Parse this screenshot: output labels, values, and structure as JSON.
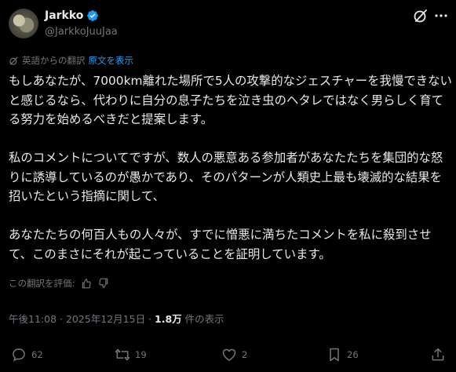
{
  "user": {
    "display_name": "Jarkko",
    "handle": "@JarkkoJuuJaa"
  },
  "translation": {
    "label": "英語からの翻訳",
    "show_original": "原文を表示"
  },
  "tweet": {
    "paragraph1": "もしあなたが、7000km離れた場所で5人の攻撃的なジェスチャーを我慢できないと感じるなら、代わりに自分の息子たちを泣き虫のヘタレではなく男らしく育てる努力を始めるべきだと提案します。",
    "paragraph2": "私のコメントについてですが、数人の悪意ある参加者があなたたちを集団的な怒りに誘導しているのが愚かであり、そのパターンが人類史上最も壊滅的な結果を招いたという指摘に関して、",
    "paragraph3": "あなたたちの何百人もの人々が、すでに憎悪に満ちたコメントを私に殺到させて、このまさにそれが起こっていることを証明しています。"
  },
  "rating": {
    "label": "この翻訳を評価:"
  },
  "meta": {
    "time": "午後11:08",
    "separator": " · ",
    "date": "2025年12月15日",
    "views_count": "1.8万",
    "views_label": " 件の表示"
  },
  "actions": {
    "replies": "62",
    "reposts": "19",
    "likes": "2",
    "bookmarks": "26"
  },
  "colors": {
    "background": "#000000",
    "text": "#e7e9ea",
    "secondary": "#71767b",
    "accent": "#1d9bf0"
  }
}
